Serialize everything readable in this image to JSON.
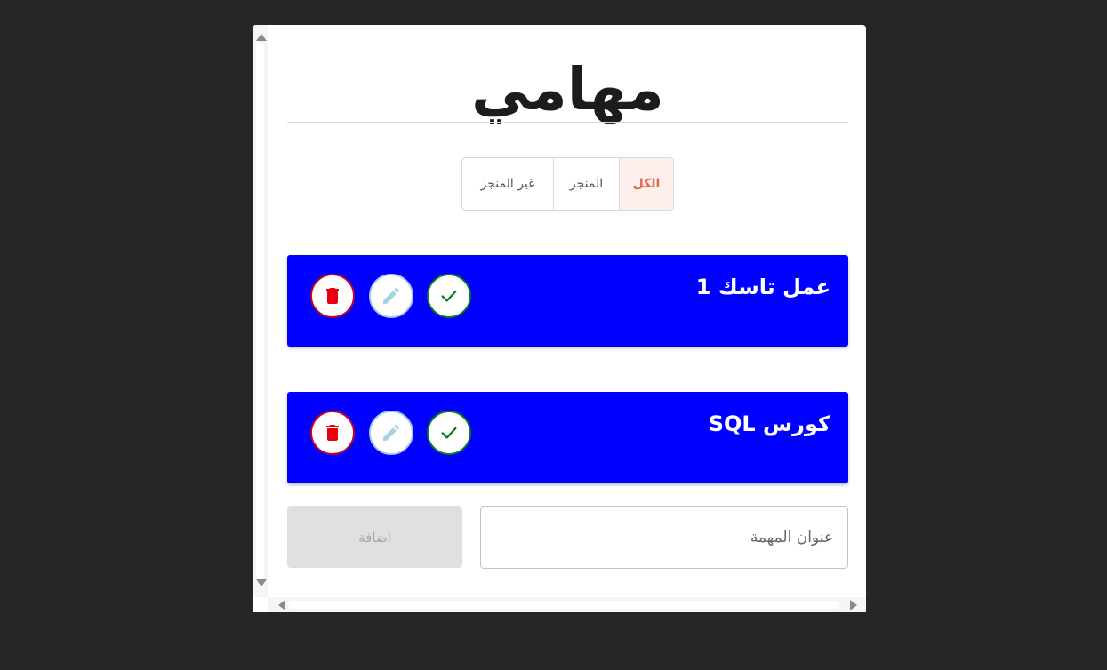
{
  "title": "مهامي",
  "filters": [
    {
      "label": "الكل",
      "active": true
    },
    {
      "label": "المنجز",
      "active": false
    },
    {
      "label": "غير المنجز",
      "active": false
    }
  ],
  "tasks": [
    {
      "title": "عمل تاسك 1"
    },
    {
      "title": "كورس SQL"
    }
  ],
  "form": {
    "input_placeholder": "عنوان المهمة",
    "input_value": "",
    "add_label": "اضافة"
  },
  "colors": {
    "background": "#262626",
    "task_card": "#0000ff",
    "active_filter_text": "#e06a50",
    "active_filter_bg": "#fdf0ec",
    "delete": "#e8000f",
    "edit": "#a8d0e6",
    "done": "#0a7a1e"
  },
  "icons": {
    "delete": "trash-icon",
    "edit": "pencil-icon",
    "done": "check-icon"
  }
}
